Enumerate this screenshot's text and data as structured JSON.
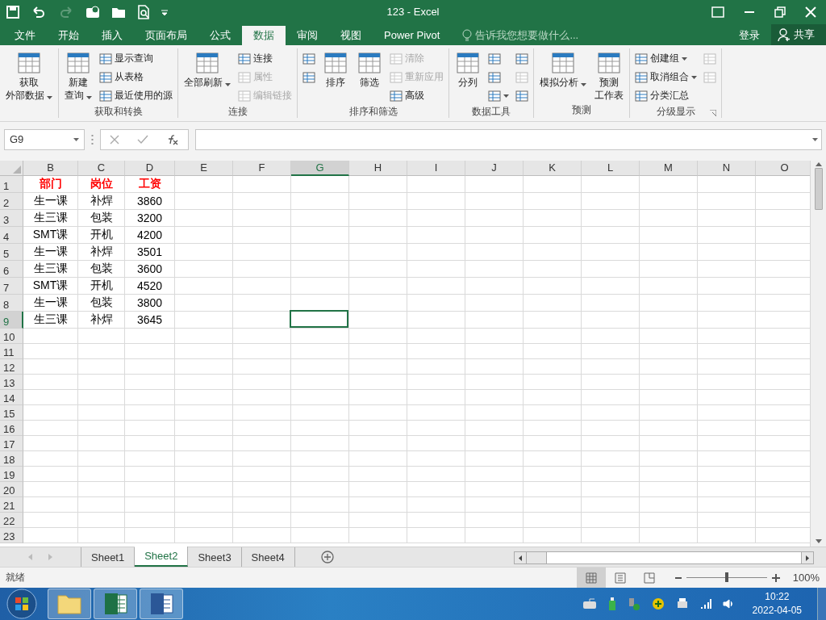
{
  "window": {
    "title": "123 - Excel"
  },
  "menu_tabs": [
    {
      "label": "文件",
      "selected": false
    },
    {
      "label": "开始",
      "selected": false
    },
    {
      "label": "插入",
      "selected": false
    },
    {
      "label": "页面布局",
      "selected": false
    },
    {
      "label": "公式",
      "selected": false
    },
    {
      "label": "数据",
      "selected": true
    },
    {
      "label": "审阅",
      "selected": false
    },
    {
      "label": "视图",
      "selected": false
    },
    {
      "label": "Power Pivot",
      "selected": false
    }
  ],
  "tell_me": {
    "placeholder": "告诉我您想要做什么..."
  },
  "account": {
    "login": "登录",
    "share": "共享"
  },
  "ribbon": {
    "groups": [
      {
        "items": [
          {
            "kind": "large",
            "lines": [
              "获取",
              "外部数据"
            ],
            "dropdown": true,
            "disabled": false
          }
        ]
      },
      {
        "label": "获取和转换",
        "items": [
          {
            "kind": "large",
            "lines": [
              "新建",
              "查询"
            ],
            "dropdown": true,
            "disabled": false
          },
          {
            "kind": "stack",
            "items": [
              {
                "label": "显示查询",
                "dropdown": false,
                "disabled": false
              },
              {
                "label": "从表格",
                "dropdown": false,
                "disabled": false
              },
              {
                "label": "最近使用的源",
                "dropdown": false,
                "disabled": false
              }
            ]
          }
        ]
      },
      {
        "label": "连接",
        "items": [
          {
            "kind": "large",
            "lines": [
              "全部刷新"
            ],
            "dropdown": true,
            "disabled": false
          },
          {
            "kind": "stack",
            "items": [
              {
                "label": "连接",
                "dropdown": false,
                "disabled": false
              },
              {
                "label": "属性",
                "dropdown": false,
                "disabled": true
              },
              {
                "label": "编辑链接",
                "dropdown": false,
                "disabled": true
              }
            ]
          }
        ]
      },
      {
        "label": "排序和筛选",
        "items": [
          {
            "kind": "stack",
            "items": [
              {
                "dropdown": false,
                "disabled": false
              },
              {
                "dropdown": false,
                "disabled": false
              }
            ]
          },
          {
            "kind": "large",
            "lines": [
              "排序"
            ],
            "dropdown": false,
            "disabled": false
          },
          {
            "kind": "large",
            "lines": [
              "筛选"
            ],
            "dropdown": false,
            "disabled": false
          },
          {
            "kind": "stack",
            "items": [
              {
                "label": "清除",
                "dropdown": false,
                "disabled": true
              },
              {
                "label": "重新应用",
                "dropdown": false,
                "disabled": true
              },
              {
                "label": "高级",
                "dropdown": false,
                "disabled": false
              }
            ]
          }
        ]
      },
      {
        "label": "数据工具",
        "items": [
          {
            "kind": "large",
            "lines": [
              "分列"
            ],
            "dropdown": false,
            "disabled": false
          },
          {
            "kind": "stack",
            "items": [
              {
                "dropdown": false,
                "disabled": false
              },
              {
                "dropdown": false,
                "disabled": false
              },
              {
                "dropdown": true,
                "disabled": false
              }
            ]
          },
          {
            "kind": "stack",
            "items": [
              {
                "dropdown": false,
                "disabled": false
              },
              {
                "dropdown": false,
                "disabled": true
              },
              {
                "dropdown": false,
                "disabled": false
              }
            ]
          }
        ]
      },
      {
        "label": "预测",
        "items": [
          {
            "kind": "large",
            "lines": [
              "模拟分析"
            ],
            "dropdown": true,
            "disabled": false
          },
          {
            "kind": "large",
            "lines": [
              "预测",
              "工作表"
            ],
            "dropdown": false,
            "disabled": false
          }
        ]
      },
      {
        "label": "分级显示",
        "launcher": true,
        "items": [
          {
            "kind": "stack",
            "items": [
              {
                "label": "创建组",
                "dropdown": true,
                "disabled": false
              },
              {
                "label": "取消组合",
                "dropdown": true,
                "disabled": false
              },
              {
                "label": "分类汇总",
                "dropdown": false,
                "disabled": false
              }
            ]
          },
          {
            "kind": "stack",
            "items": [
              {
                "dropdown": false,
                "disabled": true
              },
              {
                "dropdown": false,
                "disabled": true
              }
            ]
          }
        ]
      }
    ]
  },
  "formula_bar": {
    "name_box": "G9"
  },
  "sheet": {
    "columns": [
      {
        "label": "B",
        "selected": false
      },
      {
        "label": "C",
        "selected": false
      },
      {
        "label": "D",
        "selected": false
      },
      {
        "label": "E",
        "selected": false
      },
      {
        "label": "F",
        "selected": false
      },
      {
        "label": "G",
        "selected": true
      },
      {
        "label": "H",
        "selected": false
      },
      {
        "label": "I",
        "selected": false
      },
      {
        "label": "J",
        "selected": false
      },
      {
        "label": "K",
        "selected": false
      },
      {
        "label": "L",
        "selected": false
      },
      {
        "label": "M",
        "selected": false
      },
      {
        "label": "N",
        "selected": false
      },
      {
        "label": "O",
        "selected": false
      }
    ],
    "rows": [
      {
        "number": "1",
        "kind": "header",
        "selected": false,
        "cells": [
          "部门",
          "岗位",
          "工资"
        ]
      },
      {
        "number": "2",
        "kind": "data",
        "selected": false,
        "cells": [
          "生一课",
          "补焊",
          "3860"
        ]
      },
      {
        "number": "3",
        "kind": "data",
        "selected": false,
        "cells": [
          "生三课",
          "包装",
          "3200"
        ]
      },
      {
        "number": "4",
        "kind": "data",
        "selected": false,
        "cells": [
          "SMT课",
          "开机",
          "4200"
        ]
      },
      {
        "number": "5",
        "kind": "data",
        "selected": false,
        "cells": [
          "生一课",
          "补焊",
          "3501"
        ]
      },
      {
        "number": "6",
        "kind": "data",
        "selected": false,
        "cells": [
          "生三课",
          "包装",
          "3600"
        ]
      },
      {
        "number": "7",
        "kind": "data",
        "selected": false,
        "cells": [
          "SMT课",
          "开机",
          "4520"
        ]
      },
      {
        "number": "8",
        "kind": "data",
        "selected": false,
        "cells": [
          "生一课",
          "包装",
          "3800"
        ]
      },
      {
        "number": "9",
        "kind": "data",
        "selected": true,
        "cells": [
          "生三课",
          "补焊",
          "3645"
        ]
      },
      {
        "number": "10",
        "kind": "empty",
        "selected": false
      },
      {
        "number": "11",
        "kind": "empty",
        "selected": false
      },
      {
        "number": "12",
        "kind": "empty",
        "selected": false
      },
      {
        "number": "13",
        "kind": "empty",
        "selected": false
      },
      {
        "number": "14",
        "kind": "empty",
        "selected": false
      },
      {
        "number": "15",
        "kind": "empty",
        "selected": false
      },
      {
        "number": "16",
        "kind": "empty",
        "selected": false
      },
      {
        "number": "17",
        "kind": "empty",
        "selected": false
      },
      {
        "number": "18",
        "kind": "empty",
        "selected": false
      },
      {
        "number": "19",
        "kind": "empty",
        "selected": false
      },
      {
        "number": "20",
        "kind": "empty",
        "selected": false
      },
      {
        "number": "21",
        "kind": "empty",
        "selected": false
      },
      {
        "number": "22",
        "kind": "empty",
        "selected": false
      },
      {
        "number": "23",
        "kind": "empty",
        "selected": false
      }
    ]
  },
  "sheet_tabs": [
    {
      "label": "Sheet1",
      "selected": false
    },
    {
      "label": "Sheet2",
      "selected": true
    },
    {
      "label": "Sheet3",
      "selected": false
    },
    {
      "label": "Sheet4",
      "selected": false
    }
  ],
  "status_bar": {
    "status": "就绪",
    "views": [
      {
        "selected": true
      },
      {
        "selected": false
      },
      {
        "selected": false
      }
    ],
    "zoom": {
      "level": 0.5,
      "reading": "100%"
    }
  },
  "taskbar": {
    "apps": [
      {
        "kind": "folder"
      },
      {
        "kind": "excel"
      },
      {
        "kind": "word"
      }
    ],
    "time": "10:22",
    "date": "2022-04-05"
  }
}
